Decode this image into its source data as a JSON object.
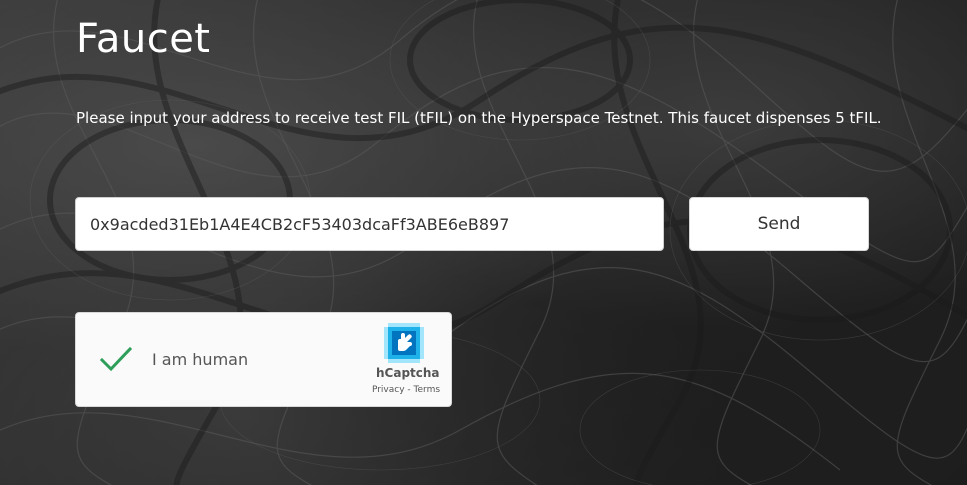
{
  "page": {
    "title": "Faucet",
    "description": "Please input your address to receive test FIL (tFIL) on the Hyperspace Testnet. This faucet dispenses 5 tFIL."
  },
  "form": {
    "address_value": "0x9acded31Eb1A4E4CB2cF53403dcaFf3ABE6eB897",
    "send_label": "Send"
  },
  "captcha": {
    "label": "I am human",
    "checked": true,
    "brand": "hCaptcha",
    "privacy_link": "Privacy",
    "separator": " - ",
    "terms_link": "Terms",
    "check_icon": "checkmark-icon",
    "logo_icon": "hcaptcha-logo-icon"
  },
  "colors": {
    "check_green": "#2e9e5a",
    "logo_blue": "#0074bf",
    "logo_light": "#00bfff"
  }
}
